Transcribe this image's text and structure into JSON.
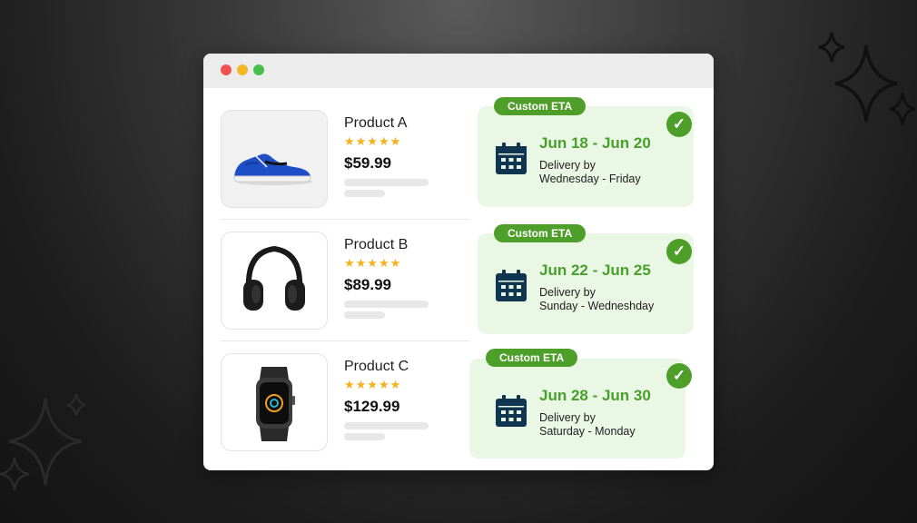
{
  "window": {
    "controls": [
      "close",
      "minimize",
      "maximize"
    ]
  },
  "products": [
    {
      "name": "Product A",
      "rating": "★★★★★",
      "price": "$59.99",
      "image": "blue-sneaker"
    },
    {
      "name": "Product B",
      "rating": "★★★★★",
      "price": "$89.99",
      "image": "black-headphones"
    },
    {
      "name": "Product C",
      "rating": "★★★★★",
      "price": "$129.99",
      "image": "smartwatch"
    }
  ],
  "eta_cards": [
    {
      "badge": "Custom ETA",
      "range": "Jun 18 - Jun 20",
      "label": "Delivery by",
      "days": "Wednesday - Friday",
      "icon": "calendar-icon"
    },
    {
      "badge": "Custom ETA",
      "range": "Jun 22 - Jun 25",
      "label": "Delivery by",
      "days": "Sunday - Wedneshday",
      "icon": "calendar-icon"
    },
    {
      "badge": "Custom ETA",
      "range": "Jun 28 - Jun 30",
      "label": "Delivery by",
      "days": "Saturday - Monday",
      "icon": "calendar-icon"
    }
  ],
  "check_glyph": "✓",
  "colors": {
    "accent_green": "#4e9f2a",
    "eta_text_green": "#46a02a",
    "eta_card_bg": "#eaf7e5",
    "calendar": "#0f3550",
    "star": "#f6b21a",
    "background": "#1c1c1c"
  }
}
